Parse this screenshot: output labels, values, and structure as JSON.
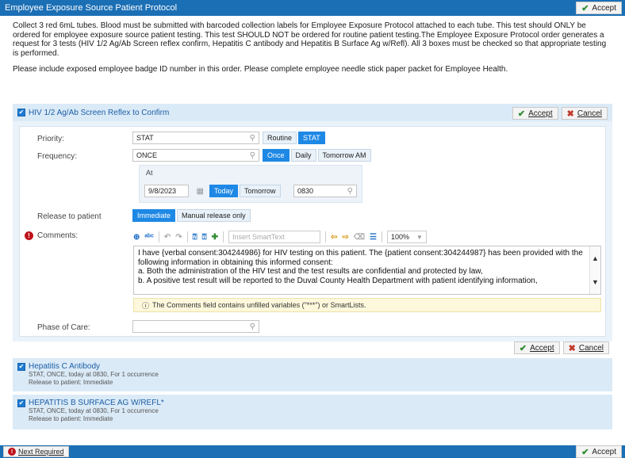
{
  "window": {
    "title": "Employee Exposure Source Patient Protocol",
    "accept_label": "Accept"
  },
  "instructions": {
    "paragraph1": "Collect 3 red 6mL tubes.  Blood must be submitted with barcoded collection labels for Employee Exposure Protocol attached to each tube. This test should ONLY be ordered for employee exposure source patient testing. This test SHOULD NOT be ordered for routine patient testing.The Employee Exposure Protocol order generates a request for 3 tests (HIV 1/2 Ag/Ab Screen reflex confirm, Hepatitis C antibody and Hepatitis B Surface Ag w/Refl). All 3 boxes must be checked so that appropriate testing is performed.",
    "paragraph2": "Please include exposed employee badge ID number in this order. Please complete employee needle stick paper packet for Employee Health."
  },
  "order1": {
    "name": "HIV 1/2 Ag/Ab Screen Reflex to Confirm",
    "accept_label": "Accept",
    "cancel_label": "Cancel",
    "priority": {
      "label": "Priority:",
      "value": "STAT",
      "options": [
        "Routine",
        "STAT"
      ],
      "selected": "STAT"
    },
    "frequency": {
      "label": "Frequency:",
      "value": "ONCE",
      "options": [
        "Once",
        "Daily",
        "Tomorrow AM"
      ],
      "selected": "Once"
    },
    "at": {
      "label": "At",
      "date": "9/8/2023",
      "date_options": [
        "Today",
        "Tomorrow"
      ],
      "date_selected": "Today",
      "time": "0830"
    },
    "release": {
      "label": "Release to patient",
      "options": [
        "Immediate",
        "Manual release only"
      ],
      "selected": "Immediate"
    },
    "comments": {
      "label": "Comments:",
      "smarttext_placeholder": "Insert SmartText",
      "zoom": "100%",
      "text_line1": "I have {verbal consent:304244986} for HIV testing on this patient.  The {patient consent:304244987} has been provided with the following information in obtaining this informed consent:",
      "text_line2": "a. Both the administration of the HIV test and the test results are confidential and protected by law,",
      "text_line3": "b. A positive test result will be reported to the Duval County Health Department with patient identifying information,",
      "warning": "The Comments field contains unfilled variables (\"***\") or SmartLists."
    },
    "phase_of_care": {
      "label": "Phase of Care:",
      "value": ""
    }
  },
  "order2": {
    "name": "Hepatitis C Antibody",
    "detail1": "STAT, ONCE, today at 0830, For 1 occurrence",
    "detail2": "Release to patient: Immediate"
  },
  "order3": {
    "name": "HEPATITIS B SURFACE AG W/REFL*",
    "detail1": "STAT, ONCE, today at 0830, For 1 occurrence",
    "detail2": "Release to patient: Immediate"
  },
  "footer": {
    "next_required_label": "Next Required",
    "accept_label": "Accept"
  },
  "colors": {
    "titlebar": "#1b6fb5",
    "selected_chip": "#1e88e5",
    "order_header": "#dbeaf7",
    "required_icon": "#c0141c"
  }
}
